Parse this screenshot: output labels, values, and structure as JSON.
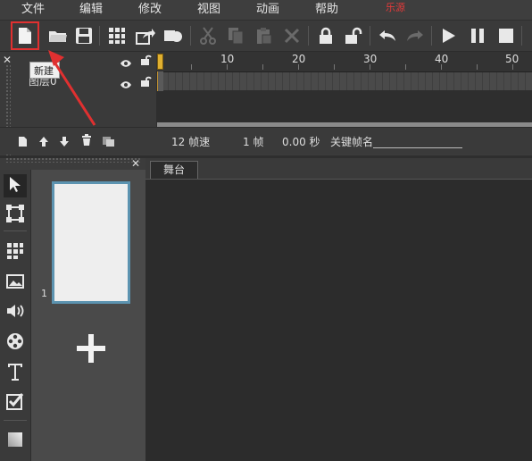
{
  "menu": {
    "items": [
      "文件",
      "编辑",
      "修改",
      "视图",
      "动画",
      "帮助"
    ],
    "extra": "乐源"
  },
  "toolbar": {
    "icons": [
      "new-file-icon",
      "open-folder-icon",
      "save-icon",
      "grid-icon",
      "share-icon",
      "record-icon",
      "cut-icon",
      "copy-icon",
      "paste-icon",
      "delete-icon",
      "lock-icon",
      "unlock-icon",
      "undo-icon",
      "redo-icon",
      "play-icon",
      "pause-icon",
      "stop-icon"
    ],
    "tooltip": "新建"
  },
  "timeline": {
    "layer_name": "图层0",
    "ruler_labels": [
      "10",
      "20",
      "30",
      "40",
      "50"
    ],
    "fps": "12 帧速",
    "frame": "1 帧",
    "time": "0.00 秒",
    "keyframe_label": "关键帧名"
  },
  "stage": {
    "tab_label": "舞台"
  },
  "scenes": {
    "items": [
      {
        "number": "1"
      }
    ],
    "add_symbol": "+"
  },
  "colors": {
    "highlight_red": "#e03030",
    "playhead": "#e0b030",
    "scene_border": "#5c93b0"
  }
}
